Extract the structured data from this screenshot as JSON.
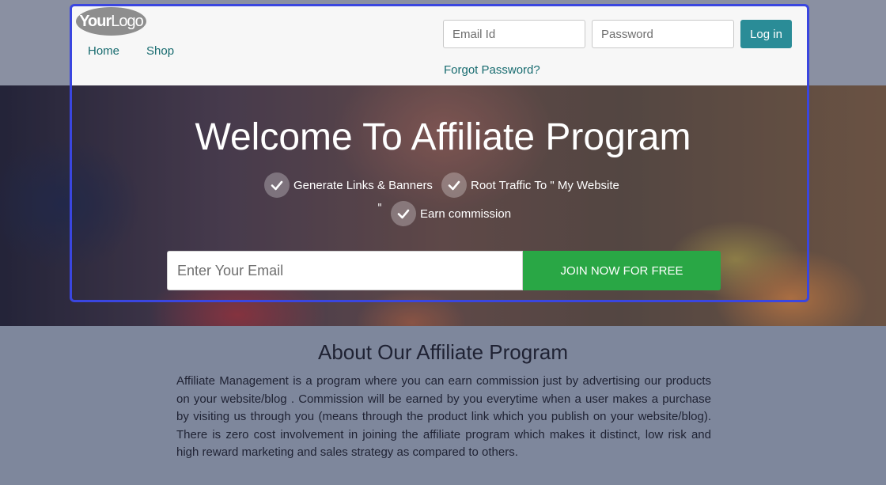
{
  "header": {
    "logo": {
      "bold": "Your",
      "light": "Logo"
    },
    "nav": [
      "Home",
      "Shop"
    ],
    "login": {
      "email_placeholder": "Email Id",
      "password_placeholder": "Password",
      "button": "Log in",
      "forgot": "Forgot Password?"
    }
  },
  "hero": {
    "title": "Welcome To Affiliate Program",
    "features": [
      "Generate Links & Banners",
      "Root Traffic To \" My Website",
      "Earn commission"
    ],
    "stray_quote": "\"",
    "signup": {
      "email_placeholder": "Enter Your Email",
      "button": "JOIN NOW FOR FREE"
    }
  },
  "about": {
    "title": "About Our Affiliate Program",
    "text": "Affiliate Management is a program where you can earn commission just by advertising our products on your website/blog . Commission will be earned by you everytime when a user makes a purchase by visiting us through you (means through the product link which you publish on your website/blog). There is zero cost involvement in joining the affiliate program which makes it distinct, low risk and high reward marketing and sales strategy as compared to others."
  },
  "colors": {
    "accent": "#2a8c97",
    "join": "#29a745",
    "nav_link": "#176b6f",
    "frame": "#3a46e0"
  }
}
